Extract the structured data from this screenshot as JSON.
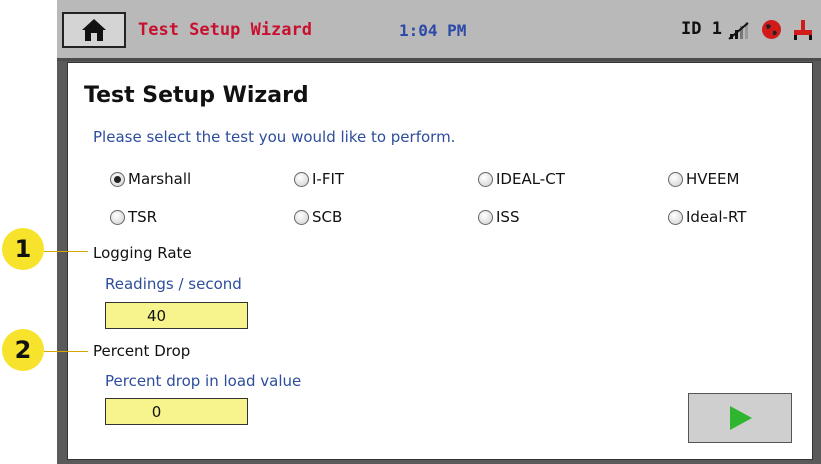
{
  "topbar": {
    "app_title": "Test Setup Wizard",
    "time": "1:04 PM",
    "device_id": "ID 1",
    "icons": [
      "home-icon",
      "no-signal-icon",
      "globe-icon",
      "hydraulic-icon"
    ]
  },
  "wizard": {
    "title": "Test Setup Wizard",
    "instruction": "Please select the test you would like to perform.",
    "tests": [
      {
        "label": "Marshall",
        "selected": true
      },
      {
        "label": "I-FIT",
        "selected": false
      },
      {
        "label": "IDEAL-CT",
        "selected": false
      },
      {
        "label": "HVEEM",
        "selected": false
      },
      {
        "label": "TSR",
        "selected": false
      },
      {
        "label": "SCB",
        "selected": false
      },
      {
        "label": "ISS",
        "selected": false
      },
      {
        "label": "Ideal-RT",
        "selected": false
      }
    ],
    "logging_rate": {
      "heading": "Logging Rate",
      "label": "Readings / second",
      "value": "40"
    },
    "percent_drop": {
      "heading": "Percent Drop",
      "label": "Percent drop in load value",
      "value": "0"
    }
  },
  "callouts": [
    "1",
    "2"
  ],
  "colors": {
    "accent_red": "#c8102e",
    "time_blue": "#2e4aa8",
    "input_yellow": "#f7f48e",
    "callout_yellow": "#f7e32b",
    "play_green": "#2fb52f"
  }
}
